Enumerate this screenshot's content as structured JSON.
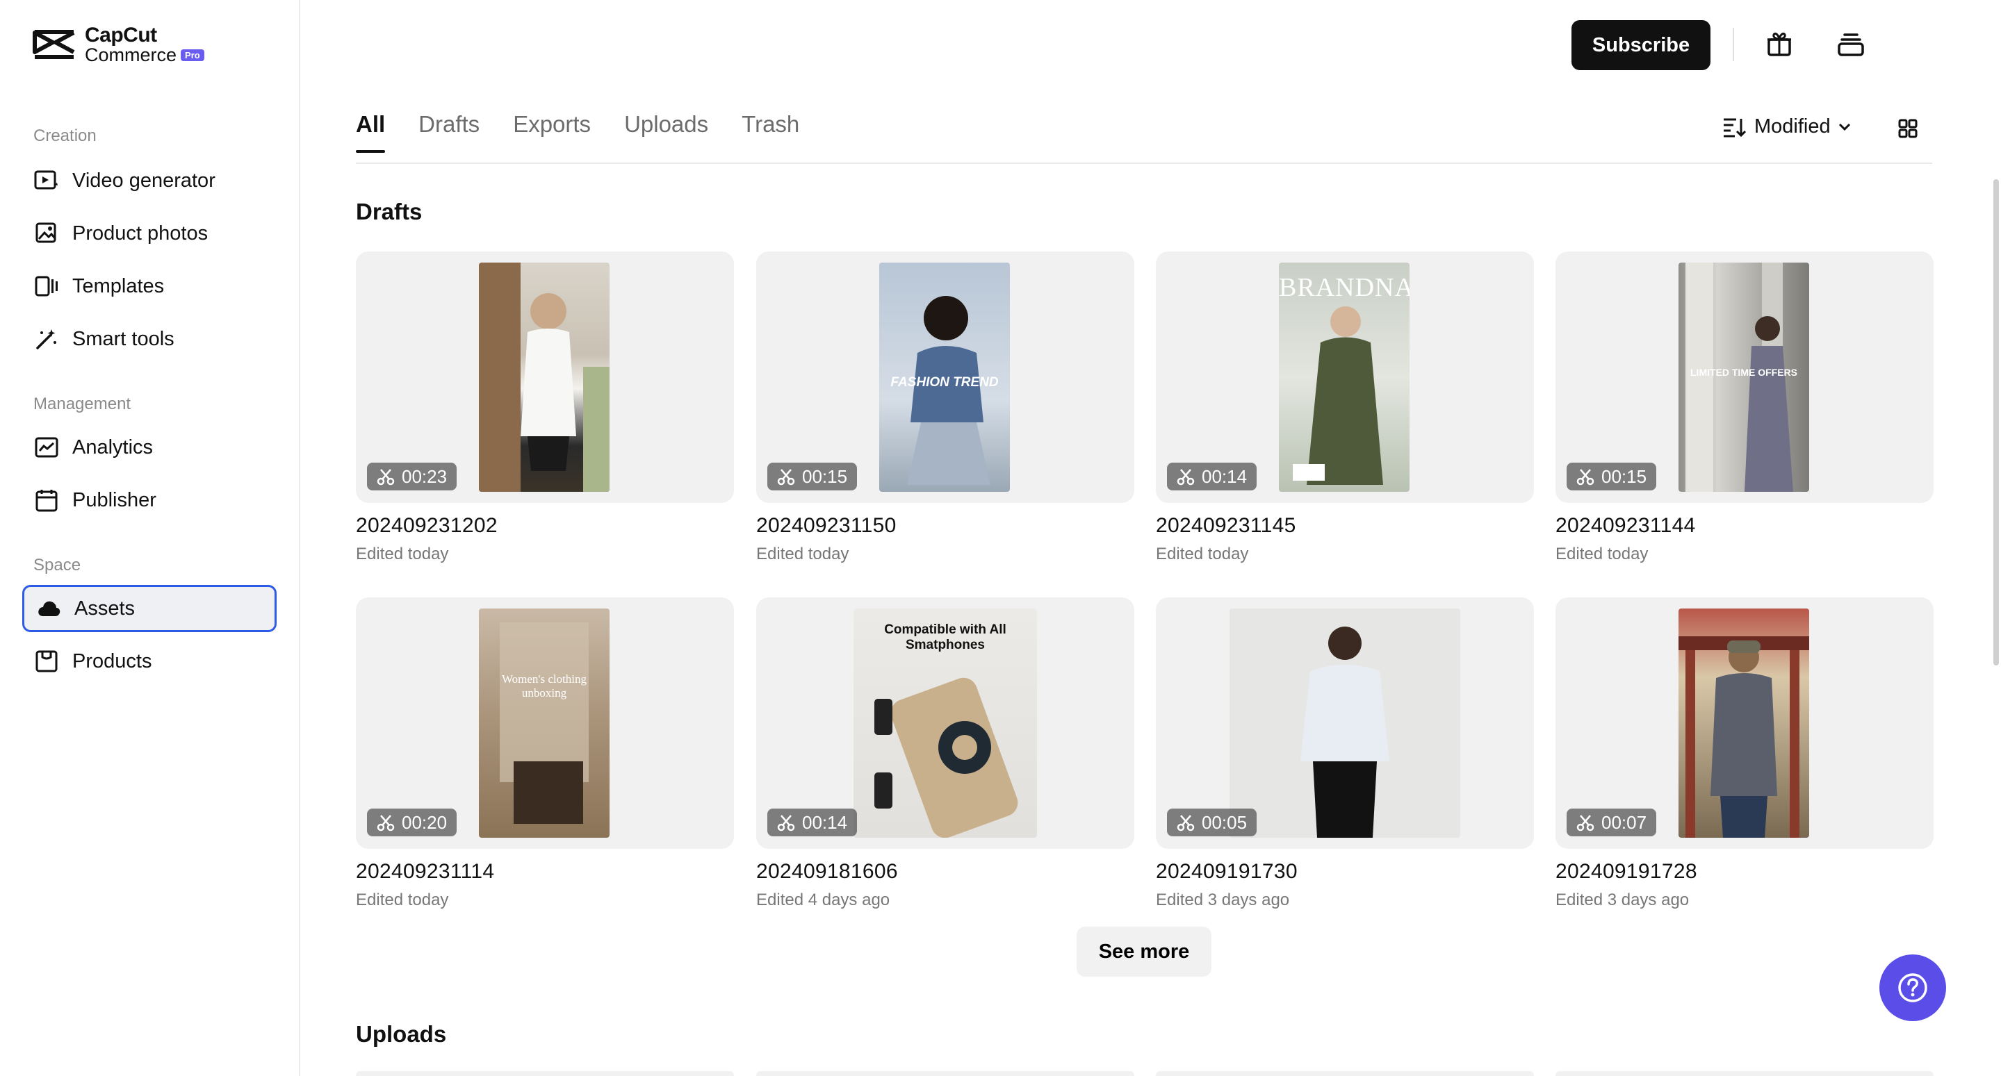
{
  "brand": {
    "line1": "CapCut",
    "line2": "Commerce",
    "badge": "Pro"
  },
  "sidebar": {
    "sections": [
      {
        "label": "Creation"
      },
      {
        "label": "Management"
      },
      {
        "label": "Space"
      }
    ],
    "items": [
      {
        "label": "Video generator",
        "icon": "video-generator-icon"
      },
      {
        "label": "Product photos",
        "icon": "product-photos-icon"
      },
      {
        "label": "Templates",
        "icon": "templates-icon"
      },
      {
        "label": "Smart tools",
        "icon": "magic-wand-icon"
      },
      {
        "label": "Analytics",
        "icon": "analytics-icon"
      },
      {
        "label": "Publisher",
        "icon": "calendar-icon"
      },
      {
        "label": "Assets",
        "icon": "cloud-icon",
        "active": true
      },
      {
        "label": "Products",
        "icon": "products-icon"
      }
    ]
  },
  "topbar": {
    "subscribe": "Subscribe",
    "accent": "#111111"
  },
  "tabs": [
    {
      "label": "All",
      "active": true
    },
    {
      "label": "Drafts"
    },
    {
      "label": "Exports"
    },
    {
      "label": "Uploads"
    },
    {
      "label": "Trash"
    }
  ],
  "sort": {
    "label": "Modified"
  },
  "drafts": {
    "title": "Drafts",
    "items": [
      {
        "name": "202409231202",
        "edited": "Edited today",
        "duration": "00:23"
      },
      {
        "name": "202409231150",
        "edited": "Edited today",
        "duration": "00:15",
        "overlay": "FASHION TREND"
      },
      {
        "name": "202409231145",
        "edited": "Edited today",
        "duration": "00:14",
        "overlay": "BRANDNAME"
      },
      {
        "name": "202409231144",
        "edited": "Edited today",
        "duration": "00:15",
        "overlay": "LIMITED TIME OFFERS"
      },
      {
        "name": "202409231114",
        "edited": "Edited today",
        "duration": "00:20",
        "overlay": "Women's clothing unboxing"
      },
      {
        "name": "202409181606",
        "edited": "Edited 4 days ago",
        "duration": "00:14",
        "overlay": "Compatible with All Smatphones"
      },
      {
        "name": "202409191730",
        "edited": "Edited 3 days ago",
        "duration": "00:05"
      },
      {
        "name": "202409191728",
        "edited": "Edited 3 days ago",
        "duration": "00:07"
      }
    ],
    "see_more": "See more"
  },
  "uploads": {
    "title": "Uploads"
  },
  "colors": {
    "accent": "#5b4de8",
    "active_border": "#2e5be6"
  }
}
